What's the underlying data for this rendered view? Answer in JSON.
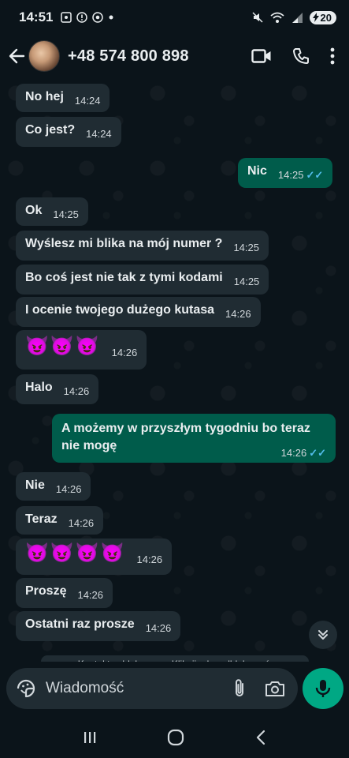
{
  "status_bar": {
    "time": "14:51",
    "battery": "20"
  },
  "header": {
    "contact": "+48 574 800 898"
  },
  "messages": [
    {
      "dir": "in",
      "text": "No hej",
      "time": "14:24"
    },
    {
      "dir": "in",
      "text": "Co jest?",
      "time": "14:24"
    },
    {
      "dir": "out",
      "text": "Nic",
      "time": "14:25"
    },
    {
      "dir": "in",
      "text": "Ok",
      "time": "14:25"
    },
    {
      "dir": "in",
      "text": "Wyślesz mi blika na mój numer ?",
      "time": "14:25"
    },
    {
      "dir": "in",
      "text": "Bo coś jest nie tak z tymi kodami",
      "time": "14:25"
    },
    {
      "dir": "in",
      "text": "I ocenie twojego dużego kutasa",
      "time": "14:26"
    },
    {
      "dir": "in",
      "text": "😈😈😈",
      "time": "14:26"
    },
    {
      "dir": "in",
      "text": "Halo",
      "time": "14:26"
    },
    {
      "dir": "out",
      "text": "A możemy w przyszłym tygodniu bo teraz nie mogę",
      "time": "14:26"
    },
    {
      "dir": "in",
      "text": "Nie",
      "time": "14:26"
    },
    {
      "dir": "in",
      "text": "Teraz",
      "time": "14:26"
    },
    {
      "dir": "in",
      "text": "😈😈😈😈",
      "time": "14:26"
    },
    {
      "dir": "in",
      "text": "Proszę",
      "time": "14:26"
    },
    {
      "dir": "in",
      "text": "Ostatni raz prosze",
      "time": "14:26"
    }
  ],
  "blocked_notice": "Kontakt zablokowany. Kliknij, aby odblokować.",
  "compose": {
    "placeholder": "Wiadomość"
  },
  "icons": {
    "back": "arrow-left-icon",
    "video": "video-call-icon",
    "phone": "phone-icon",
    "menu": "more-vert-icon",
    "sticker": "sticker-icon",
    "attach": "paperclip-icon",
    "camera": "camera-icon",
    "mic": "mic-icon",
    "scroll": "double-chevron-down-icon"
  },
  "colors": {
    "incoming": "#202c33",
    "outgoing": "#005c4b",
    "accent": "#00a884",
    "read_ticks": "#53bdeb"
  }
}
